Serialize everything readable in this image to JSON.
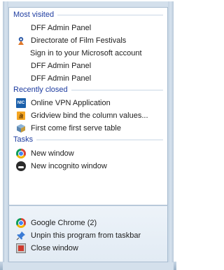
{
  "most_visited": {
    "header": "Most visited",
    "items": [
      {
        "label": "DFF Admin Panel",
        "icon": "blank"
      },
      {
        "label": "Directorate of Film Festivals",
        "icon": "festival-logo-icon"
      },
      {
        "label": "Sign in to your Microsoft account",
        "icon": "microsoft-logo-icon"
      },
      {
        "label": "DFF Admin Panel",
        "icon": "blank"
      },
      {
        "label": "DFF Admin Panel",
        "icon": "blank"
      }
    ]
  },
  "recently_closed": {
    "header": "Recently closed",
    "items": [
      {
        "label": "Online VPN Application",
        "icon": "nic-logo-icon"
      },
      {
        "label": "Gridview bind the column values...",
        "icon": "stackoverflow-icon"
      },
      {
        "label": "First come first serve table",
        "icon": "table-icon"
      }
    ]
  },
  "tasks": {
    "header": "Tasks",
    "items": [
      {
        "label": "New window",
        "icon": "chrome-icon"
      },
      {
        "label": "New incognito window",
        "icon": "incognito-icon"
      }
    ]
  },
  "app_actions": {
    "items": [
      {
        "label": "Google Chrome (2)",
        "icon": "chrome-icon"
      },
      {
        "label": "Unpin this program from taskbar",
        "icon": "unpin-icon"
      },
      {
        "label": "Close window",
        "icon": "close-window-icon"
      }
    ]
  },
  "colors": {
    "header_text": "#1e3ca0",
    "microsoft_red": "#f25022",
    "microsoft_green": "#7fba00",
    "microsoft_blue": "#00a4ef",
    "microsoft_yellow": "#ffb900"
  }
}
